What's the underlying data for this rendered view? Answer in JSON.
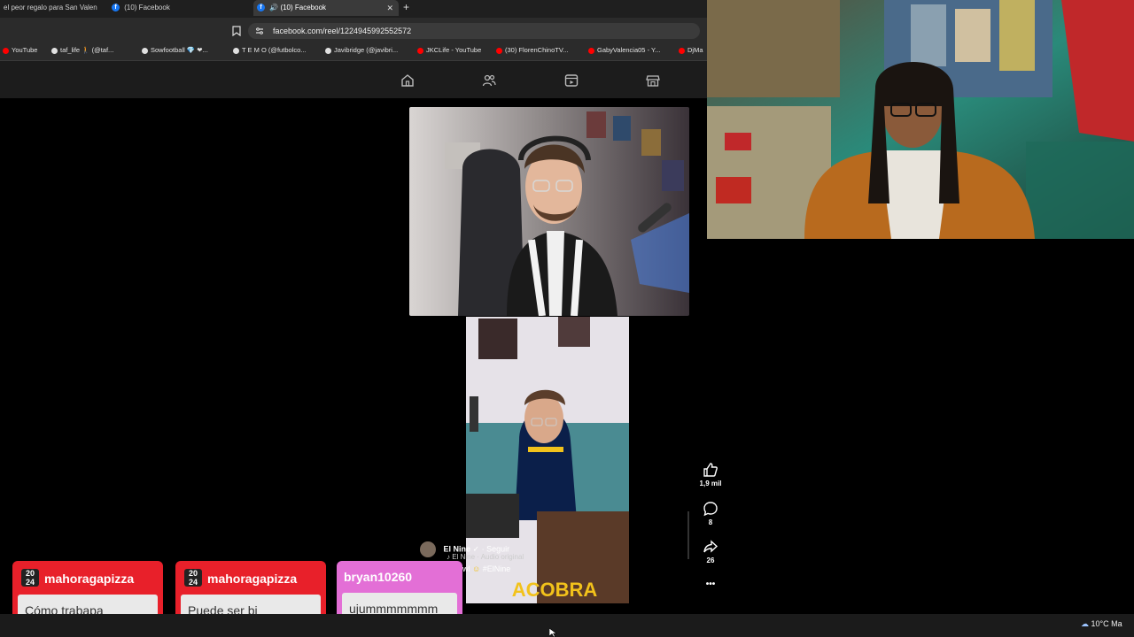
{
  "browser": {
    "tabs": [
      {
        "label": "el peor regalo para San Valen",
        "active": false
      },
      {
        "label": "(10) Facebook",
        "active": false
      },
      {
        "label": "(10) Facebook",
        "active": true
      }
    ],
    "url": "facebook.com/reel/1224945992552572",
    "bookmarks": [
      {
        "label": "YouTube",
        "color": "#ff0000"
      },
      {
        "label": "taf_life 🚶 (@taf...",
        "color": "#e0e0e0"
      },
      {
        "label": "Sowfootball 💎 ❤...",
        "color": "#e0e0e0"
      },
      {
        "label": "T E M O (@futbolco...",
        "color": "#e0e0e0"
      },
      {
        "label": "Javibridge (@javibri...",
        "color": "#e0e0e0"
      },
      {
        "label": "JKCLife - YouTube",
        "color": "#ff0000"
      },
      {
        "label": "(30) FlorenChinoTV...",
        "color": "#ff0000"
      },
      {
        "label": "GabyValencia05 - Y...",
        "color": "#ff0000"
      },
      {
        "label": "DjMa",
        "color": "#ff0000"
      }
    ]
  },
  "reel": {
    "creator": "El Nine",
    "follow_label": "Seguir",
    "audio": "El Nine · Audio original",
    "hashtag": "#ElNine",
    "caption_prefix": "wl",
    "likes": "1,9 mil",
    "comments": "8",
    "shares": "26",
    "more": "•••",
    "video_overlay": "ACOBRA"
  },
  "chat": [
    {
      "user": "mahoragapizza",
      "message": "Cómo trabapa",
      "badge": "20 24",
      "color": "#e8202a"
    },
    {
      "user": "mahoragapizza",
      "message": "Puede ser bi",
      "badge": "20 24",
      "color": "#e8202a"
    },
    {
      "user": "bryan10260",
      "message": "ujummmmmmm",
      "badge": "",
      "color": "#e36fd6"
    }
  ],
  "taskbar": {
    "weather": "10°C  Ma"
  }
}
